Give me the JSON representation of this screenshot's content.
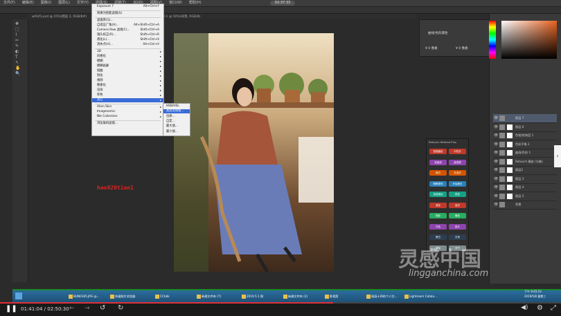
{
  "menubar": {
    "items": [
      "文件(F)",
      "编辑(E)",
      "图像(I)",
      "图层(L)",
      "文字(Y)",
      "选择(S)",
      "滤镜(T)",
      "3D(D)",
      "视图(V)",
      "窗口(W)",
      "帮助(H)"
    ],
    "timer": "02:37:33"
  },
  "tabs": [
    "wXGf1.psd @ 25%(图层 2, RGB/8#)",
    "女神.psd @ 33.3% (图层 4, RGB/8)",
    "未标题-1 @ 50%(背景, RGB/8)"
  ],
  "filter_menu": {
    "items": [
      {
        "label": "Exposure 7",
        "shortcut": "Alt+Ctrl+F"
      },
      {
        "label": "转换为智能滤镜(S)",
        "shortcut": ""
      },
      {
        "label": "滤镜库(G)...",
        "shortcut": ""
      },
      {
        "label": "自适应广角(A)...",
        "shortcut": "Alt+Shift+Ctrl+A"
      },
      {
        "label": "Camera Raw 滤镜(C)...",
        "shortcut": "Shift+Ctrl+A"
      },
      {
        "label": "镜头校正(R)...",
        "shortcut": "Shift+Ctrl+R"
      },
      {
        "label": "液化(L)...",
        "shortcut": "Shift+Ctrl+X"
      },
      {
        "label": "消失点(V)...",
        "shortcut": "Alt+Ctrl+V"
      },
      {
        "label": "3D",
        "shortcut": ""
      },
      {
        "label": "风格化",
        "shortcut": ""
      },
      {
        "label": "模糊",
        "shortcut": ""
      },
      {
        "label": "模糊画廊",
        "shortcut": ""
      },
      {
        "label": "扭曲",
        "shortcut": ""
      },
      {
        "label": "锐化",
        "shortcut": ""
      },
      {
        "label": "视频",
        "shortcut": ""
      },
      {
        "label": "像素化",
        "shortcut": ""
      },
      {
        "label": "渲染",
        "shortcut": ""
      },
      {
        "label": "杂色",
        "shortcut": ""
      },
      {
        "label": "其它",
        "shortcut": ""
      },
      {
        "label": "Alien Skin",
        "shortcut": ""
      },
      {
        "label": "Imagenomic",
        "shortcut": ""
      },
      {
        "label": "Nik Collection",
        "shortcut": ""
      },
      {
        "label": "浏览联机滤镜...",
        "shortcut": ""
      }
    ],
    "submenu": [
      "HSB/HSL",
      "高反差保留...",
      "位移...",
      "自定...",
      "最大值...",
      "最小值..."
    ]
  },
  "canvas": {
    "red_watermark": "hao920tian1"
  },
  "properties": {
    "title": "曲线/色阶属性",
    "rows": [
      "¥ 0 像素",
      "¥ 0 像素"
    ]
  },
  "layers": {
    "items": [
      {
        "name": "图层 7",
        "selected": true
      },
      {
        "name": "图层 6",
        "selected": false
      },
      {
        "name": "色相/饱和度 1",
        "selected": false
      },
      {
        "name": "色彩平衡 1",
        "selected": false
      },
      {
        "name": "曲线/色阶 1",
        "selected": false
      },
      {
        "name": "Retouch 磨皮 (光敏)",
        "selected": false
      },
      {
        "name": "图层2",
        "selected": false
      },
      {
        "name": "图层 3",
        "selected": false
      },
      {
        "name": "图层 4",
        "selected": false
      },
      {
        "name": "图层 5",
        "selected": false
      },
      {
        "name": "背景",
        "selected": false
      }
    ]
  },
  "plugin": {
    "title": "Retouch Refined Plus",
    "buttons": [
      "智能磨皮",
      "中性灰",
      "双曲线",
      "高低频",
      "美白",
      "去油光",
      "眼睛提亮",
      "牙齿美白",
      "加深减淡",
      "锐化",
      "液化",
      "高光",
      "阴影",
      "暖色",
      "冷色",
      "胶片",
      "黑白",
      "日系",
      "清除",
      "关于"
    ]
  },
  "watermark": {
    "logo": "灵感中国",
    "url": "lingganchina.com"
  },
  "taskbar": {
    "tasks": [
      "BUN0185.JPG @...",
      "快速照片浏览器",
      "CCtalk",
      "新建文件夹 (7)",
      "2019.5.1 照",
      "新建文件夹 (2)",
      "影视剪",
      "插画十四的个人空...",
      "Lightroom Catalo..."
    ],
    "clock": "下午 9:45:23",
    "date": "2019/5/8 星期三"
  },
  "player": {
    "time": "01:41:04 / 02:50:30",
    "progress": 0.594,
    "play_icon": "play-pause-icon"
  }
}
